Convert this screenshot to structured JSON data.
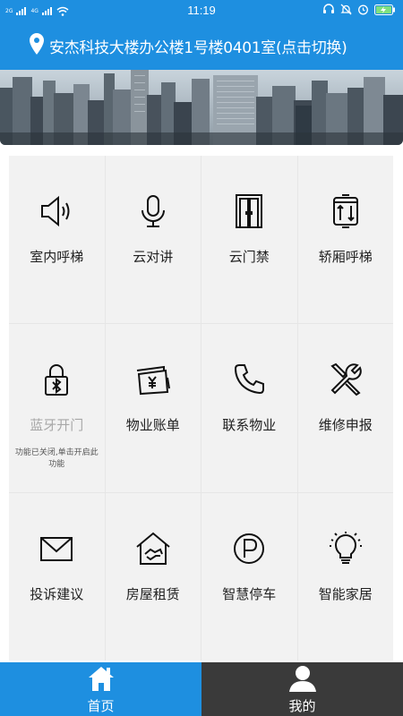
{
  "status_bar": {
    "network_tag_1": "2G",
    "network_tag_2": "4G",
    "time": "11:19"
  },
  "location": {
    "text": "安杰科技大楼办公楼1号楼0401室(点击切换)",
    "icon": "location-pin-icon"
  },
  "colors": {
    "primary": "#1e8fe0",
    "nav_dark": "#3a3a3a",
    "grid_bg": "#f2f2f2",
    "disabled_text": "#a8a8a8"
  },
  "grid": {
    "items": [
      {
        "label": "室内呼梯",
        "icon": "speaker-icon"
      },
      {
        "label": "云对讲",
        "icon": "microphone-icon"
      },
      {
        "label": "云门禁",
        "icon": "door-icon"
      },
      {
        "label": "轿厢呼梯",
        "icon": "elevator-icon"
      },
      {
        "label": "蓝牙开门",
        "icon": "bluetooth-lock-icon",
        "note": "功能已关闭,单击开启此功能"
      },
      {
        "label": "物业账单",
        "icon": "bill-icon"
      },
      {
        "label": "联系物业",
        "icon": "phone-icon"
      },
      {
        "label": "维修申报",
        "icon": "tools-icon"
      },
      {
        "label": "投诉建议",
        "icon": "mail-icon"
      },
      {
        "label": "房屋租赁",
        "icon": "house-handshake-icon"
      },
      {
        "label": "智慧停车",
        "icon": "parking-icon"
      },
      {
        "label": "智能家居",
        "icon": "lightbulb-icon"
      }
    ]
  },
  "bottom_nav": {
    "home_label": "首页",
    "mine_label": "我的"
  }
}
